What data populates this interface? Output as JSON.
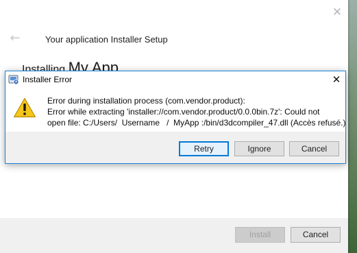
{
  "installer": {
    "title": "Your application Installer Setup",
    "installing_prefix": "Installing",
    "app_name": "My App",
    "install_label": "Install",
    "cancel_label": "Cancel"
  },
  "error_dialog": {
    "title": "Installer Error",
    "message_lines": [
      "Error during installation process (com.vendor.product):",
      "Error while extracting 'installer://com.vendor.product/0.0.0bin.7z': Could not",
      "open file: C:/Users/  Username   /  MyApp :/bin/d3dcompiler_47.dll (Accès refusé.)"
    ],
    "buttons": {
      "retry": "Retry",
      "ignore": "Ignore",
      "cancel": "Cancel"
    },
    "focused_button": "retry",
    "icon": "warning-icon",
    "accent_color": "#1883d7"
  }
}
